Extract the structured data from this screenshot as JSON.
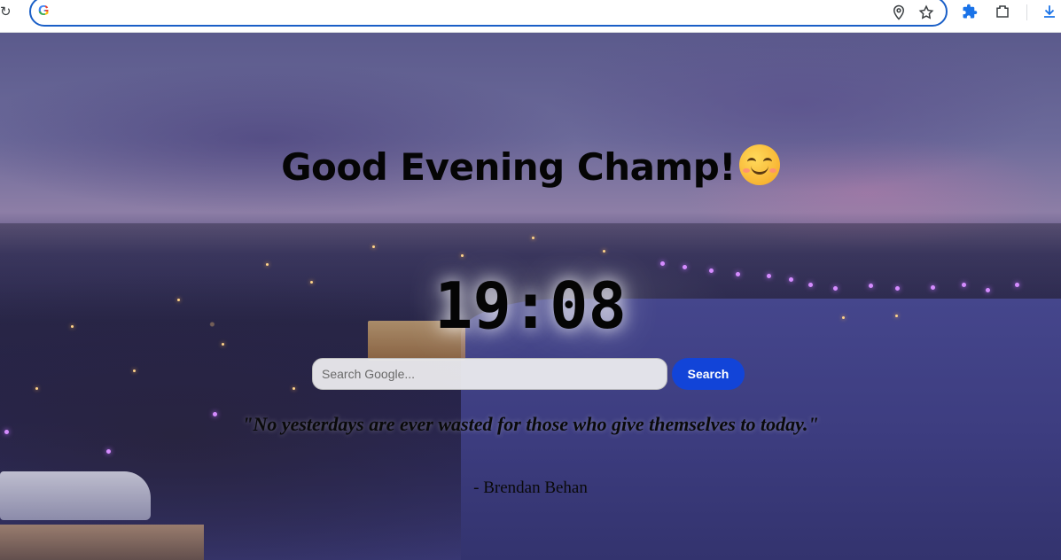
{
  "browser": {
    "address_value": "",
    "icons": {
      "reload": "reload-icon",
      "search_engine": "google-icon",
      "location": "location-pin-icon",
      "bookmark": "star-icon",
      "extensions": "puzzle-icon",
      "side_panel": "frame-icon",
      "downloads": "download-icon"
    },
    "accent_color": "#1a5fc7"
  },
  "greeting": {
    "text": "Good Evening Champ!",
    "emoji": "smiling-face-emoji"
  },
  "clock": {
    "time": "19:08"
  },
  "search": {
    "placeholder": "Search Google...",
    "value": "",
    "button_label": "Search",
    "button_color": "#1244d8"
  },
  "quote": {
    "text": "\"No yesterdays are ever wasted for those who give themselves to today.\"",
    "author": "- Brendan Behan"
  },
  "background": {
    "scene": "night-city-waterfront-photo"
  }
}
